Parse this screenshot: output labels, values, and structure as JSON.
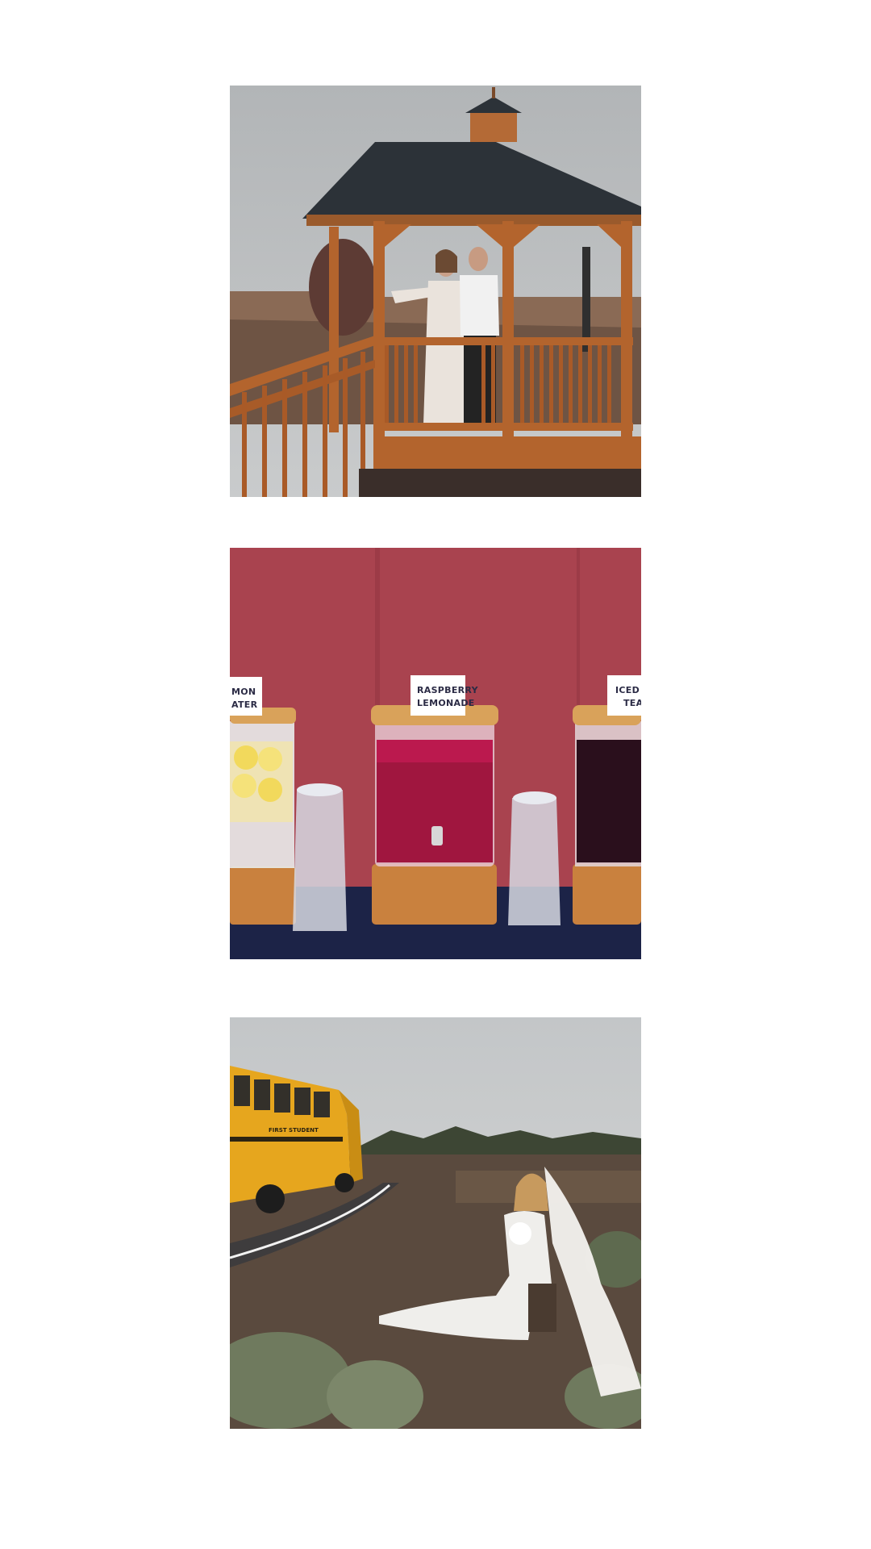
{
  "photos": [
    {
      "subject": "couple-in-gazebo"
    },
    {
      "subject": "drink-dispensers"
    },
    {
      "subject": "bride-with-school-bus"
    }
  ],
  "dispenser_labels": {
    "left": [
      "MON",
      "ATER"
    ],
    "center": [
      "RASPBERRY",
      "LEMONADE"
    ],
    "right": [
      "ICED",
      "TEA"
    ]
  },
  "bus_side_text": "FIRST STUDENT",
  "colors": {
    "background": "#ffffff",
    "sky": "#b9bcbf",
    "wood": "#b3642d",
    "roof": "#2c3238",
    "wall": "#a9434f",
    "tablecloth": "#1c2347",
    "bus": "#e6a61e"
  }
}
